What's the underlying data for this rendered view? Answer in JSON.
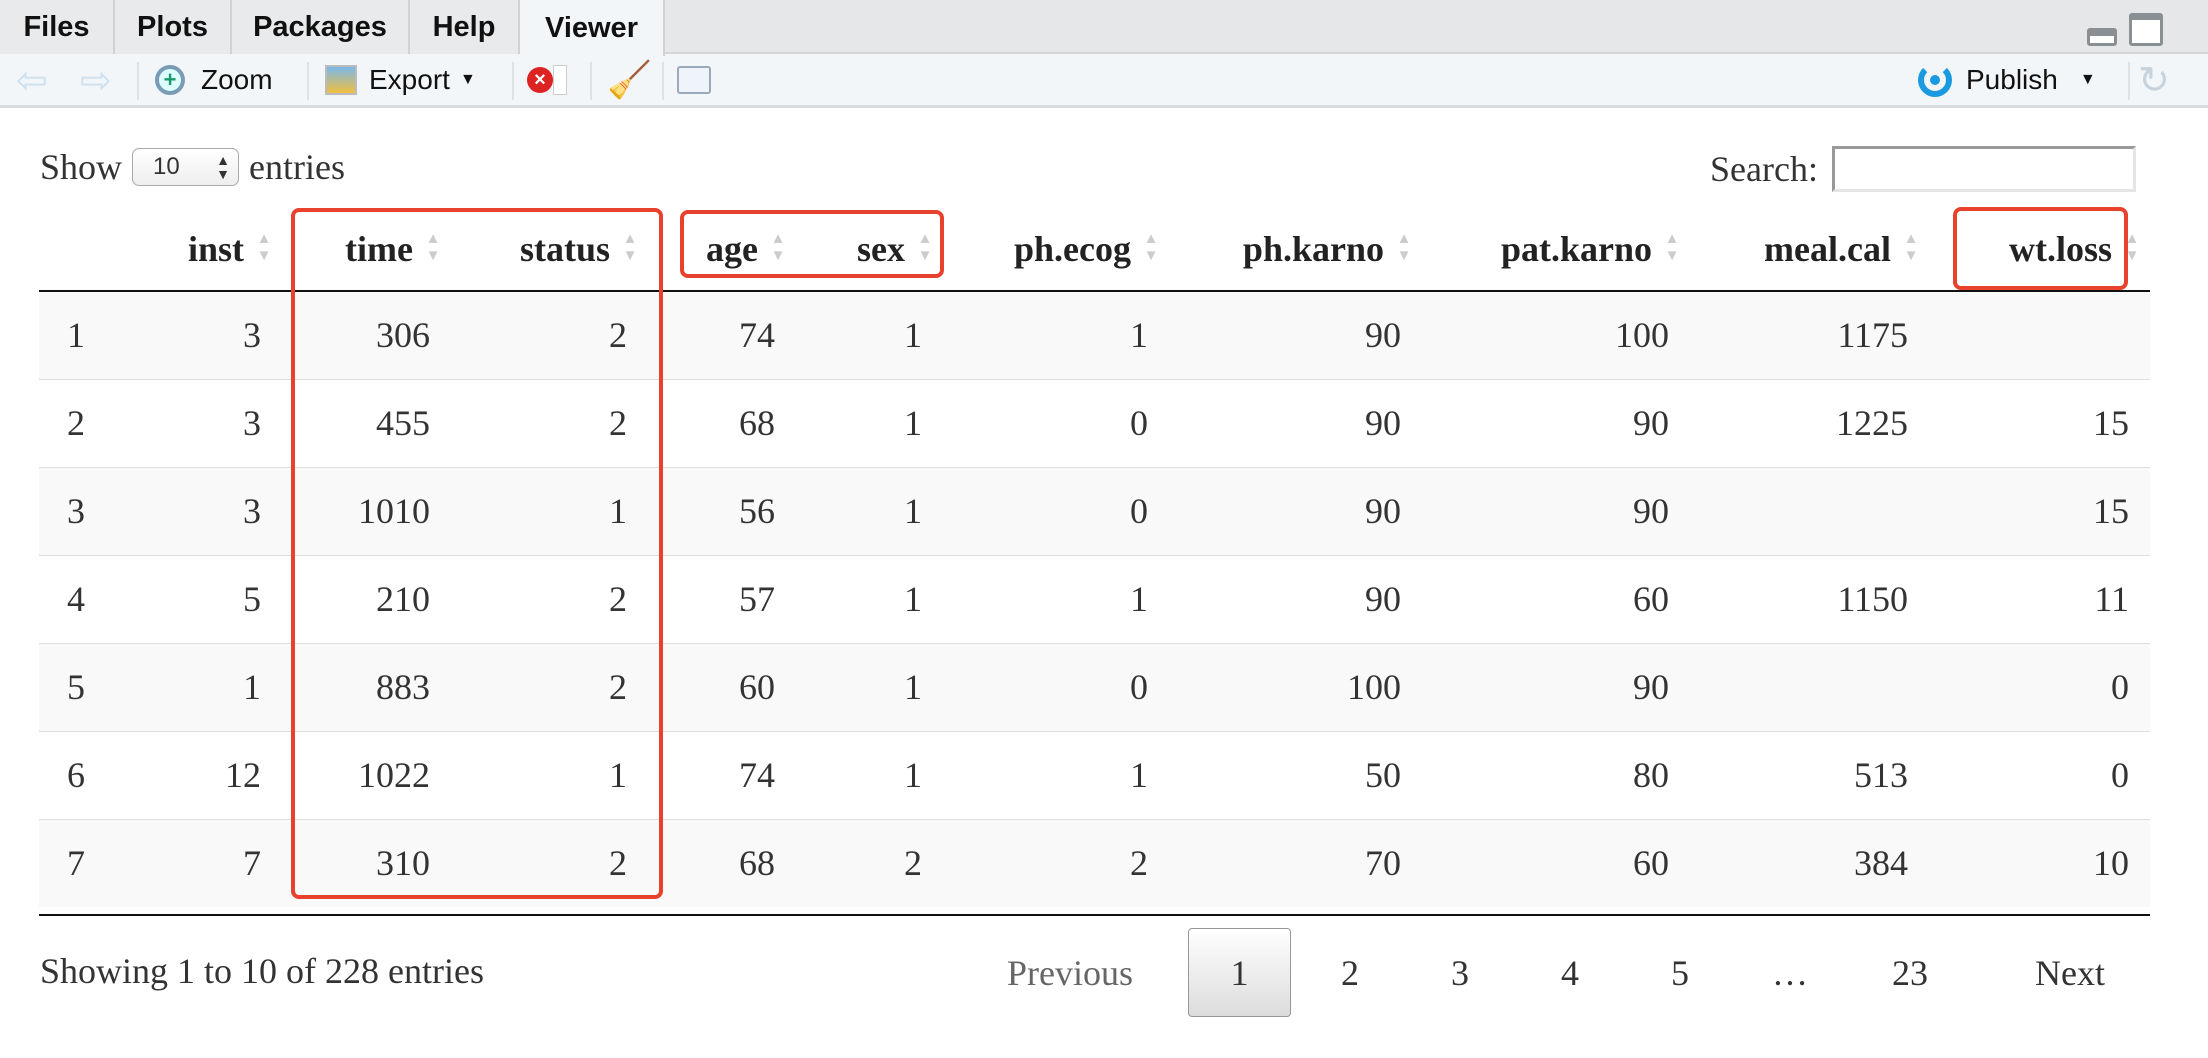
{
  "tabs": [
    {
      "label": "Files"
    },
    {
      "label": "Plots"
    },
    {
      "label": "Packages"
    },
    {
      "label": "Help"
    },
    {
      "label": "Viewer",
      "active": true
    }
  ],
  "toolbar": {
    "zoom": "Zoom",
    "export": "Export",
    "publish": "Publish"
  },
  "controls": {
    "show": "Show",
    "entries": "entries",
    "page_length": "10",
    "search_label": "Search:",
    "search_value": ""
  },
  "table": {
    "columns": [
      "",
      "inst",
      "time",
      "status",
      "age",
      "sex",
      "ph.ecog",
      "ph.karno",
      "pat.karno",
      "meal.cal",
      "wt.loss"
    ],
    "rows": [
      [
        "1",
        "3",
        "306",
        "2",
        "74",
        "1",
        "1",
        "90",
        "100",
        "1175",
        ""
      ],
      [
        "2",
        "3",
        "455",
        "2",
        "68",
        "1",
        "0",
        "90",
        "90",
        "1225",
        "15"
      ],
      [
        "3",
        "3",
        "1010",
        "1",
        "56",
        "1",
        "0",
        "90",
        "90",
        "",
        "15"
      ],
      [
        "4",
        "5",
        "210",
        "2",
        "57",
        "1",
        "1",
        "90",
        "60",
        "1150",
        "11"
      ],
      [
        "5",
        "1",
        "883",
        "2",
        "60",
        "1",
        "0",
        "100",
        "90",
        "",
        "0"
      ],
      [
        "6",
        "12",
        "1022",
        "1",
        "74",
        "1",
        "1",
        "50",
        "80",
        "513",
        "0"
      ],
      [
        "7",
        "7",
        "310",
        "2",
        "68",
        "2",
        "2",
        "70",
        "60",
        "384",
        "10"
      ]
    ]
  },
  "footer": {
    "info": "Showing 1 to 10 of 228 entries",
    "previous": "Previous",
    "pages": [
      "1",
      "2",
      "3",
      "4",
      "5",
      "…",
      "23"
    ],
    "current_page": "1",
    "next": "Next"
  },
  "colors": {
    "highlight": "#e8412c",
    "publish": "#1a9ae0"
  }
}
